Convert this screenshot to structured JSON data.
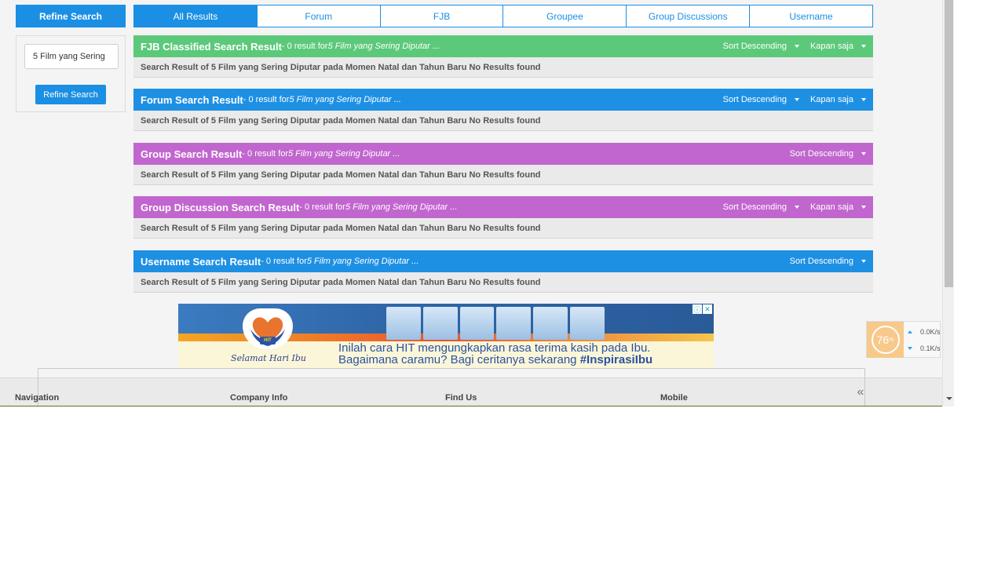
{
  "refine": {
    "header": "Refine Search",
    "input_value": "5 Film yang Sering",
    "button": "Refine Search"
  },
  "tabs": [
    {
      "label": "All Results",
      "active": true
    },
    {
      "label": "Forum",
      "active": false
    },
    {
      "label": "FJB",
      "active": false
    },
    {
      "label": "Groupee",
      "active": false
    },
    {
      "label": "Group Discussions",
      "active": false
    },
    {
      "label": "Username",
      "active": false
    }
  ],
  "sections": [
    {
      "title": "FJB Classified Search Result",
      "meta": " - 0 result for ",
      "query": "5 Film yang Sering Diputar ...",
      "sort": "Sort Descending",
      "time": "Kapan saja",
      "body": "Search Result of 5 Film yang Sering Diputar pada Momen Natal dan Tahun Baru No Results found",
      "color": "#5cc97a"
    },
    {
      "title": "Forum Search Result",
      "meta": " - 0 result for ",
      "query": "5 Film yang Sering Diputar ...",
      "sort": "Sort Descending",
      "time": "Kapan saja",
      "body": "Search Result of 5 Film yang Sering Diputar pada Momen Natal dan Tahun Baru No Results found",
      "color": "#1e90e4"
    },
    {
      "title": "Group Search Result",
      "meta": " - 0 result for ",
      "query": "5 Film yang Sering Diputar ...",
      "sort": "Sort Descending",
      "body": "Search Result of 5 Film yang Sering Diputar pada Momen Natal dan Tahun Baru No Results found",
      "color": "#c266cf"
    },
    {
      "title": "Group Discussion Search Result",
      "meta": " - 0 result for ",
      "query": "5 Film yang Sering Diputar ...",
      "sort": "Sort Descending",
      "time": "Kapan saja",
      "body": "Search Result of 5 Film yang Sering Diputar pada Momen Natal dan Tahun Baru No Results found",
      "color": "#c266cf"
    },
    {
      "title": "Username Search Result",
      "meta": " - 0 result for ",
      "query": "5 Film yang Sering Diputar ...",
      "sort": "Sort Descending",
      "body": "Search Result of 5 Film yang Sering Diputar pada Momen Natal dan Tahun Baru No Results found",
      "color": "#1e90e4"
    }
  ],
  "ad": {
    "badge": "HIT",
    "tagline": "Selamat Hari Ibu",
    "line1": "Inilah cara HIT mengungkapkan rasa terima kasih pada Ibu.",
    "line2_prefix": "Bagaimana caramu? Bagi ceritanya sekarang ",
    "line2_hashtag": "#InspirasiIbu"
  },
  "footer": {
    "col1": "Navigation",
    "col2": "Company Info",
    "col3": "Find Us",
    "col4": "Mobile",
    "collapse": "«"
  },
  "widget": {
    "percent": "76",
    "percent_unit": "%",
    "up": "0.0K/s",
    "down": "0.1K/s"
  }
}
